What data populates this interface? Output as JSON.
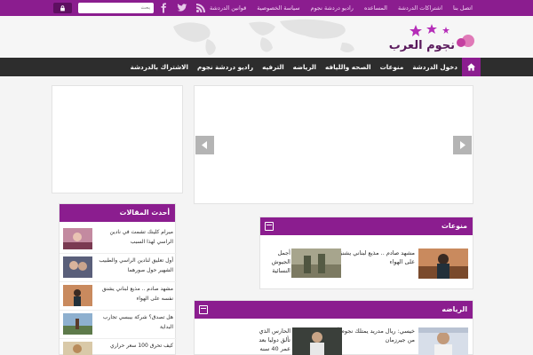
{
  "topbar": {
    "links": [
      "اتصل بنا",
      "اشتراكات الدردشة",
      "المساعده",
      "راديو دردشة نجوم",
      "سياسة الخصوصية",
      "قوانين الدردشة"
    ],
    "search_placeholder": "بحث",
    "social_icons": [
      "facebook-icon",
      "twitter-icon",
      "rss-icon"
    ],
    "color": "#8b1d8f"
  },
  "logo": {
    "text": "نجوم العرب"
  },
  "mainnav": {
    "items": [
      "دخول الدردشة",
      "منوعات",
      "الصحه والليافه",
      "الرياضه",
      "الترفيه",
      "راديو دردشة نجوم",
      "الاشتراك بالدردشة"
    ]
  },
  "variety": {
    "title": "منوعات",
    "items": [
      {
        "title": "مشهد صادم .. مذيع لبناني يشنق نفسه على الهواء"
      },
      {
        "title": "أجمل الجيوش النسائية"
      }
    ]
  },
  "sport": {
    "title": "الرياضه",
    "items": [
      {
        "title": "خيسي: ريال مدريد يمتلك نجوم أفضل من جيرزمان"
      },
      {
        "title": "الحارس الذي تألق دوليا بعد عمر 40 سنه"
      }
    ]
  },
  "latest": {
    "title": "أحدث المقالات",
    "items": [
      {
        "title": "ميرام كلينك تشمت في نادين الراسي لهذا السبب"
      },
      {
        "title": "أول تعليق لنادين الراسي والطبيب الشهير حول صورهما"
      },
      {
        "title": "مشهد صادم .. مذيع لبناني يشنق نفسه على الهواء"
      },
      {
        "title": "هل تصدق؟ شركة بيبسي تجارب البداية"
      },
      {
        "title": "كيف تحرق 100 سعر حراري"
      }
    ]
  }
}
